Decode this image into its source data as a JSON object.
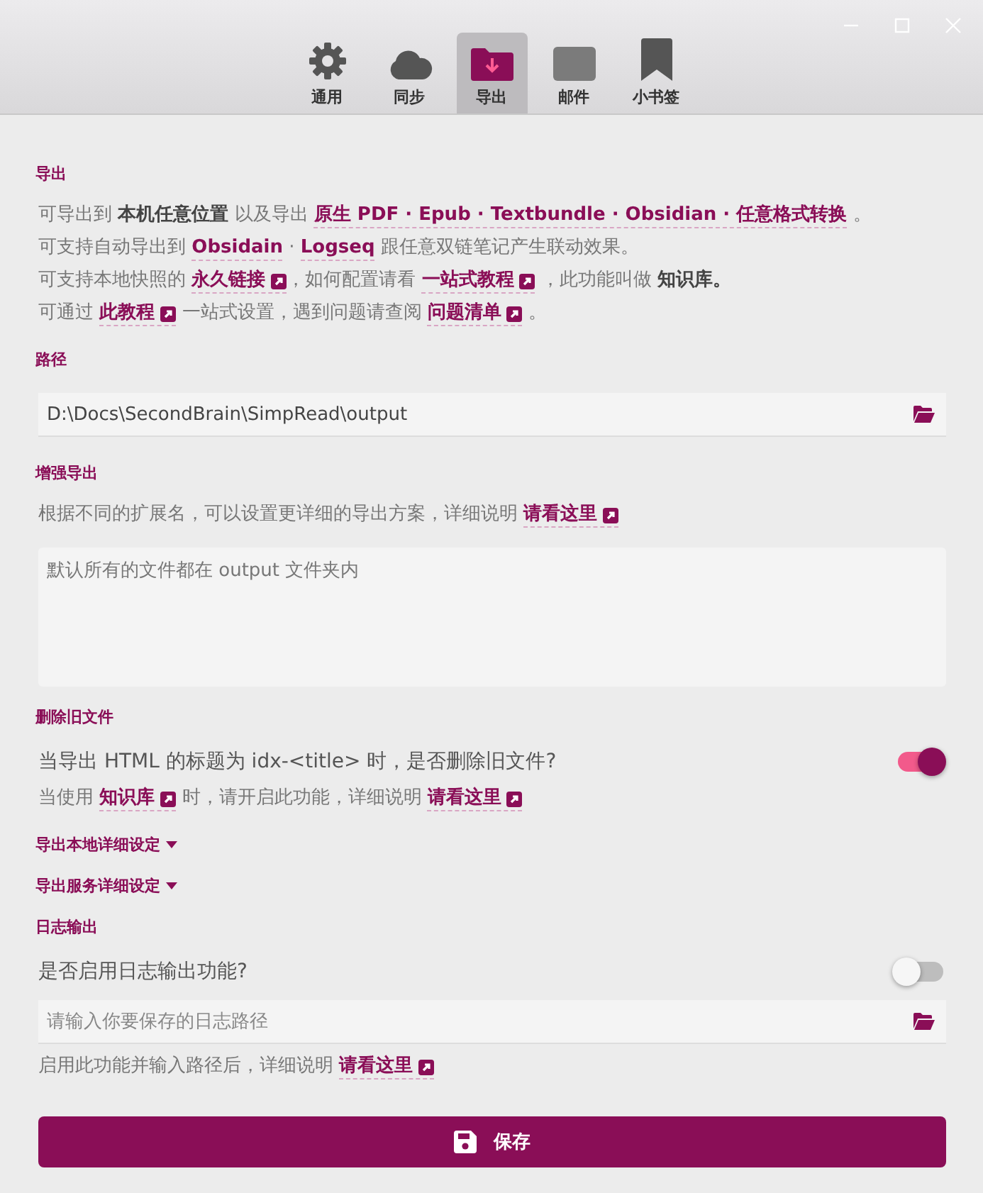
{
  "tabs": [
    {
      "label": "通用",
      "selected": false
    },
    {
      "label": "同步",
      "selected": false
    },
    {
      "label": "导出",
      "selected": true
    },
    {
      "label": "邮件",
      "selected": false
    },
    {
      "label": "小书签",
      "selected": false
    }
  ],
  "sections": [
    {
      "title": "导出",
      "items": [
        {
          "kind": "paragraph",
          "segments": [
            {
              "kind": "text",
              "text": "可导出到 "
            },
            {
              "kind": "bold",
              "text": "本机任意位置"
            },
            {
              "kind": "text",
              "text": " 以及导出 "
            },
            {
              "kind": "link",
              "text": "原生 PDF · Epub · Textbundle · Obsidian · 任意格式转换",
              "external": false
            },
            {
              "kind": "text",
              "text": " 。"
            }
          ]
        },
        {
          "kind": "paragraph",
          "segments": [
            {
              "kind": "text",
              "text": "可支持自动导出到 "
            },
            {
              "kind": "link",
              "text": "Obsidain",
              "external": false
            },
            {
              "kind": "text",
              "text": " · "
            },
            {
              "kind": "link",
              "text": "Logseq",
              "external": false
            },
            {
              "kind": "text",
              "text": " 跟任意双链笔记产生联动效果。"
            }
          ]
        },
        {
          "kind": "paragraph",
          "segments": [
            {
              "kind": "text",
              "text": "可支持本地快照的 "
            },
            {
              "kind": "link",
              "text": "永久链接",
              "external": true
            },
            {
              "kind": "text",
              "text": "，如何配置请看 "
            },
            {
              "kind": "link",
              "text": "一站式教程",
              "external": true
            },
            {
              "kind": "text",
              "text": " ，此功能叫做 "
            },
            {
              "kind": "bold",
              "text": "知识库。"
            }
          ]
        },
        {
          "kind": "paragraph",
          "segments": [
            {
              "kind": "text",
              "text": "可通过 "
            },
            {
              "kind": "link",
              "text": "此教程",
              "external": true
            },
            {
              "kind": "text",
              "text": " 一站式设置，遇到问题请查阅 "
            },
            {
              "kind": "link",
              "text": "问题清单",
              "external": true
            },
            {
              "kind": "text",
              "text": " 。"
            }
          ]
        }
      ]
    },
    {
      "title": "路径",
      "items": [
        {
          "kind": "path",
          "value": "D:\\Docs\\SecondBrain\\SimpRead\\output"
        }
      ]
    },
    {
      "title": "增强导出",
      "items": [
        {
          "kind": "paragraph",
          "segments": [
            {
              "kind": "text",
              "text": "根据不同的扩展名，可以设置更详细的导出方案，详细说明 "
            },
            {
              "kind": "link",
              "text": "请看这里",
              "external": true
            }
          ]
        },
        {
          "kind": "textarea",
          "placeholder": "默认所有的文件都在 output 文件夹内"
        }
      ]
    },
    {
      "title": "删除旧文件",
      "items": [
        {
          "kind": "toggle",
          "label": "当导出 HTML 的标题为 idx-<title> 时，是否删除旧文件?",
          "on": true
        },
        {
          "kind": "paragraph",
          "segments": [
            {
              "kind": "text",
              "text": "当使用 "
            },
            {
              "kind": "link",
              "text": "知识库",
              "external": true
            },
            {
              "kind": "text",
              "text": " 时，请开启此功能，详细说明 "
            },
            {
              "kind": "link",
              "text": "请看这里",
              "external": true
            }
          ]
        }
      ]
    },
    {
      "items": [
        {
          "kind": "collapsible",
          "label": "导出本地详细设定"
        }
      ]
    },
    {
      "items": [
        {
          "kind": "collapsible",
          "label": "导出服务详细设定"
        }
      ]
    },
    {
      "title": "日志输出",
      "items": [
        {
          "kind": "toggle",
          "label": "是否启用日志输出功能?",
          "on": false
        },
        {
          "kind": "path",
          "placeholder": "请输入你要保存的日志路径"
        },
        {
          "kind": "paragraph",
          "segments": [
            {
              "kind": "text",
              "text": "启用此功能并输入路径后，详细说明 "
            },
            {
              "kind": "link",
              "text": "请看这里",
              "external": true
            }
          ]
        }
      ]
    }
  ],
  "save_button": {
    "label": "保存"
  }
}
